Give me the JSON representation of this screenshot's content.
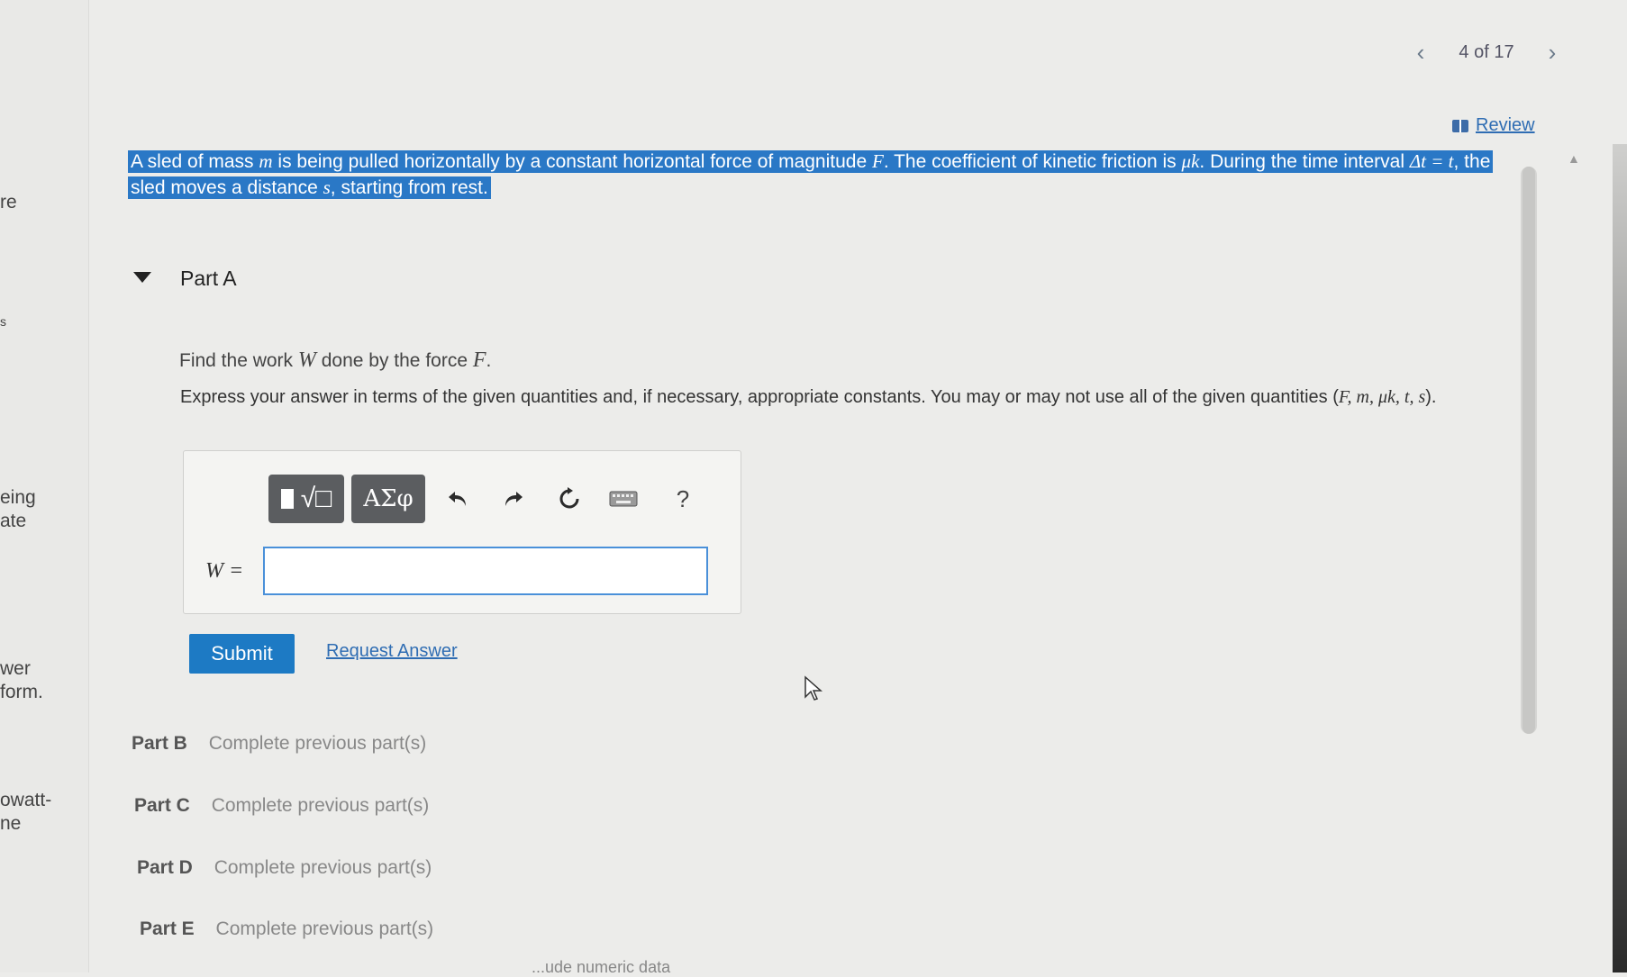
{
  "pager": {
    "prev_icon": "chevron-left-icon",
    "label": "4 of 17",
    "next_icon": "chevron-right-icon"
  },
  "review": {
    "label": "Review",
    "icon": "book-icon"
  },
  "problem": {
    "line1": [
      "A sled of mass ",
      "m",
      " is being pulled horizontally by a constant horizontal force of magnitude ",
      "F",
      ". The coefficient of kinetic friction is ",
      "μk",
      ". During the time interval ",
      "Δt = t",
      ", the"
    ],
    "line2": [
      "sled moves a distance ",
      "s",
      ", starting from rest."
    ]
  },
  "part_a": {
    "title": "Part A",
    "question": {
      "pre": "Find the work ",
      "var_w": "W",
      "mid": " done by the force ",
      "var_f": "F",
      "post": "."
    },
    "instructions": "Express your answer in terms of the given quantities and, if necessary, appropriate constants. You may or may not use all of the given quantities (",
    "instructions_vars": "F, m, μk, t, s",
    "instructions_end": ")."
  },
  "toolbar": {
    "templates_label": "√□",
    "greek_label": "ΑΣφ",
    "undo_icon": "undo-icon",
    "redo_icon": "redo-icon",
    "reset_icon": "reset-icon",
    "keyboard_icon": "keyboard-icon",
    "help_label": "?"
  },
  "answer": {
    "label": "W =",
    "value": "",
    "placeholder": ""
  },
  "actions": {
    "submit": "Submit",
    "request": "Request Answer"
  },
  "other_parts": [
    {
      "name": "Part B",
      "status": "Complete previous part(s)"
    },
    {
      "name": "Part C",
      "status": "Complete previous part(s)"
    },
    {
      "name": "Part D",
      "status": "Complete previous part(s)"
    },
    {
      "name": "Part E",
      "status": "Complete previous part(s)"
    }
  ],
  "left_fragments": [
    "re",
    "s",
    "eing",
    "ate",
    "wer",
    "form.",
    "owatt-",
    "ne"
  ],
  "bottom_fragment": "...ude numeric data",
  "colors": {
    "highlight": "#2a78c6",
    "submit": "#1d7ac4",
    "link": "#2f6db3"
  }
}
